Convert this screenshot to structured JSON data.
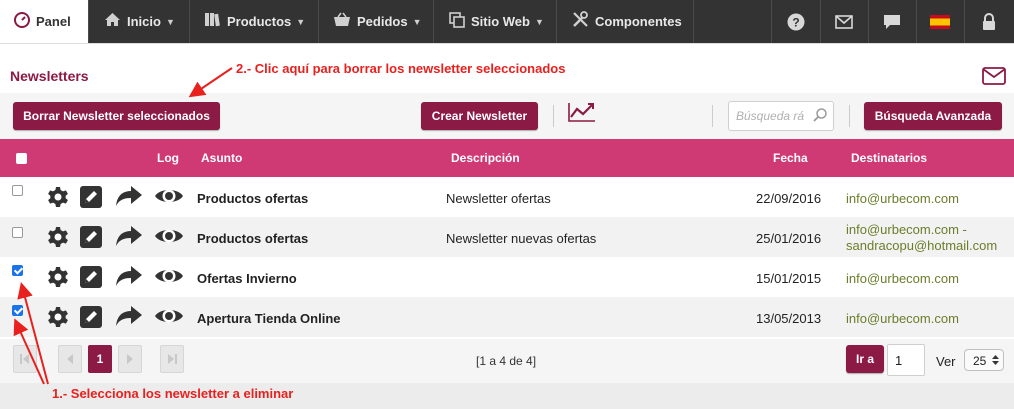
{
  "nav": {
    "panel_label": "Panel",
    "items": [
      {
        "label": "Inicio"
      },
      {
        "label": "Productos"
      },
      {
        "label": "Pedidos"
      },
      {
        "label": "Sitio Web"
      },
      {
        "label": "Componentes"
      }
    ]
  },
  "page": {
    "title": "Newsletters"
  },
  "toolbar": {
    "delete_label": "Borrar Newsletter seleccionados",
    "create_label": "Crear Newsletter",
    "search_placeholder": "Búsqueda rá",
    "advanced_label": "Búsqueda Avanzada"
  },
  "table": {
    "headers": {
      "log": "Log",
      "subject": "Asunto",
      "description": "Descripción",
      "date": "Fecha",
      "recipients": "Destinatarios"
    },
    "rows": [
      {
        "subject": "Productos ofertas",
        "description": "Newsletter ofertas",
        "date": "22/09/2016",
        "recipients_1": "info@urbecom.com",
        "recipients_2": "",
        "checked": false
      },
      {
        "subject": "Productos ofertas",
        "description": "Newsletter nuevas ofertas",
        "date": "25/01/2016",
        "recipients_1": "info@urbecom.com -",
        "recipients_2": "sandracopu@hotmail.com",
        "checked": false
      },
      {
        "subject": "Ofertas Invierno",
        "description": "",
        "date": "15/01/2015",
        "recipients_1": "info@urbecom.com",
        "recipients_2": "",
        "checked": true
      },
      {
        "subject": "Apertura Tienda Online",
        "description": "",
        "date": "13/05/2013",
        "recipients_1": "info@urbecom.com",
        "recipients_2": "",
        "checked": true
      }
    ]
  },
  "pager": {
    "current_page": "1",
    "summary": "[1 a 4 de 4]",
    "go_label": "Ir a",
    "go_value": "1",
    "view_label": "Ver",
    "per_page": "25"
  },
  "annotations": {
    "step1": "1.- Selecciona los newsletter a eliminar",
    "step2": "2.- Clic aquí para borrar los newsletter seleccionados"
  },
  "colors": {
    "accent": "#8b1a44",
    "table_header": "#cf3a74",
    "annotation": "#e8211e",
    "email": "#6b7d2a"
  }
}
